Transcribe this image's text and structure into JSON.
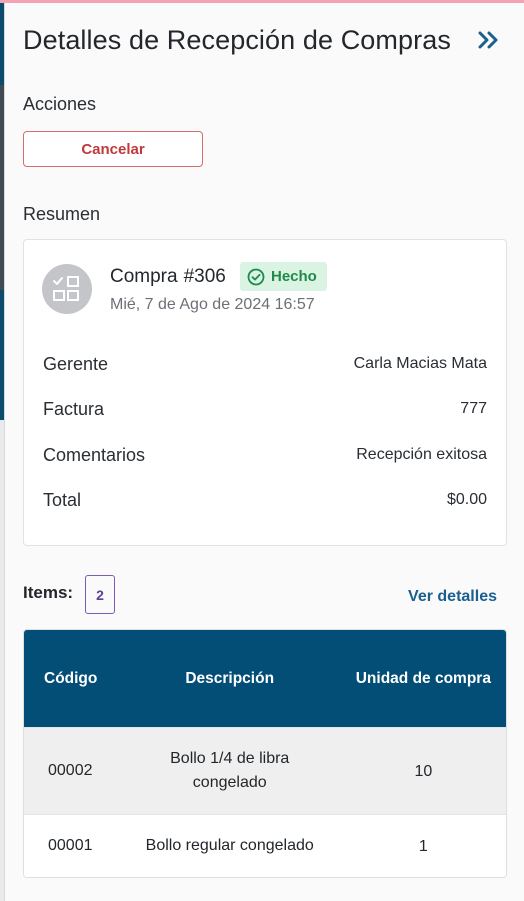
{
  "header": {
    "title": "Detalles de Recepción de Compras",
    "collapse_icon": "chevron-double-right-icon"
  },
  "actions": {
    "label": "Acciones",
    "cancel_label": "Cancelar"
  },
  "summary": {
    "label": "Resumen",
    "avatar_icon": "checklist-icon",
    "purchase_word": "Compra",
    "purchase_number": "#306",
    "status_icon": "check-circle-icon",
    "status": "Hecho",
    "date": "Mié, 7 de Ago de 2024 16:57",
    "fields": [
      {
        "key": "Gerente",
        "value": "Carla Macias Mata"
      },
      {
        "key": "Factura",
        "value": "777"
      },
      {
        "key": "Comentarios",
        "value": "Recepción exitosa"
      },
      {
        "key": "Total",
        "value": "$0.00"
      }
    ]
  },
  "items": {
    "label": "Items:",
    "count": "2",
    "details_link": "Ver detalles",
    "columns": [
      "Código",
      "Descripción",
      "Unidad de compra"
    ],
    "rows": [
      {
        "code": "00002",
        "description": "Bollo 1/4 de libra congelado",
        "unit": "10"
      },
      {
        "code": "00001",
        "description": "Bollo regular congelado",
        "unit": "1"
      }
    ]
  },
  "colors": {
    "header_bg": "#034e77",
    "cancel": "#c0393b",
    "status_bg": "#dbf3e3",
    "status_fg": "#1f8a4c",
    "link": "#1b5f8e",
    "count_border": "#7a5bb6"
  }
}
